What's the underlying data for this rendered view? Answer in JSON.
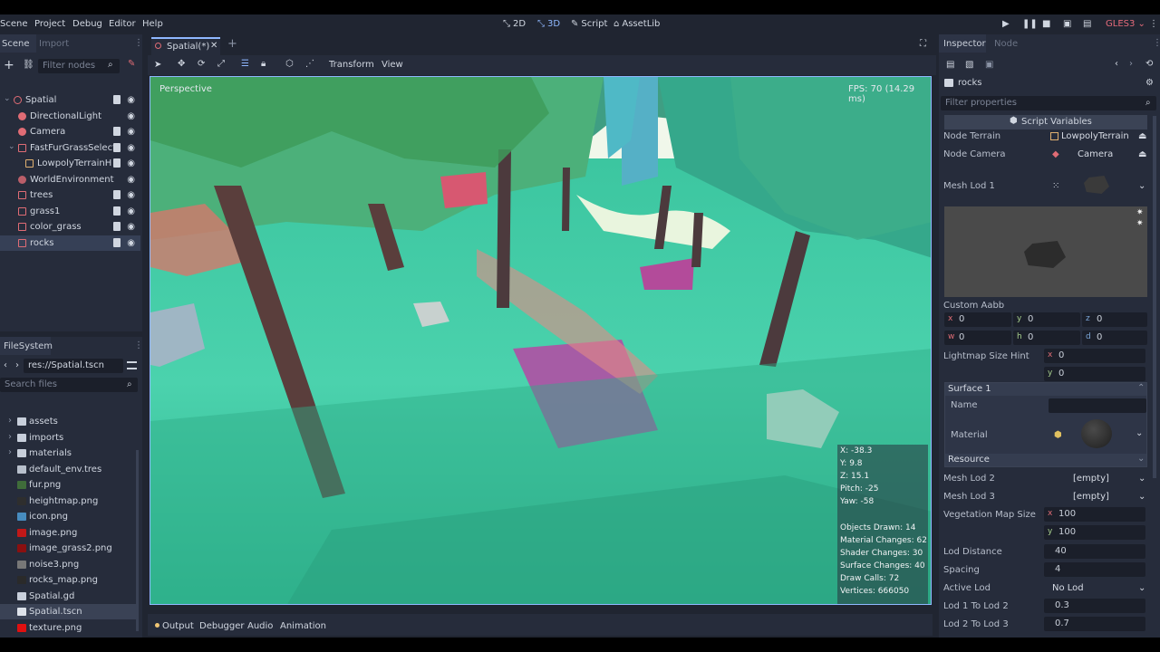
{
  "menu": [
    "Scene",
    "Project",
    "Debug",
    "Editor",
    "Help"
  ],
  "modes": {
    "d2": "2D",
    "d3": "3D",
    "script": "Script",
    "assetlib": "AssetLib"
  },
  "renderer": "GLES3",
  "scene_dock": {
    "tabs": [
      "Scene",
      "Import"
    ],
    "filter_placeholder": "Filter nodes",
    "nodes": [
      {
        "label": "Spatial"
      },
      {
        "label": "DirectionalLight"
      },
      {
        "label": "Camera"
      },
      {
        "label": "FastFurGrassSelecti"
      },
      {
        "label": "LowpolyTerrainH"
      },
      {
        "label": "WorldEnvironment"
      },
      {
        "label": "trees"
      },
      {
        "label": "grass1"
      },
      {
        "label": "color_grass"
      },
      {
        "label": "rocks"
      }
    ]
  },
  "filesystem": {
    "title": "FileSystem",
    "path": "res://Spatial.tscn",
    "search_placeholder": "Search files",
    "items": [
      {
        "label": "assets",
        "color": "#c8cfdb"
      },
      {
        "label": "imports",
        "color": "#c8cfdb"
      },
      {
        "label": "materials",
        "color": "#c8cfdb"
      },
      {
        "label": "default_env.tres",
        "color": "#b8c0cc"
      },
      {
        "label": "fur.png",
        "color": "#3f6c3a"
      },
      {
        "label": "heightmap.png",
        "color": "#2e2e2e"
      },
      {
        "label": "icon.png",
        "color": "#478cbf"
      },
      {
        "label": "image.png",
        "color": "#c01818"
      },
      {
        "label": "image_grass2.png",
        "color": "#8a1010"
      },
      {
        "label": "noise3.png",
        "color": "#777777"
      },
      {
        "label": "rocks_map.png",
        "color": "#2a2a2a"
      },
      {
        "label": "Spatial.gd",
        "color": "#c8cfdb"
      },
      {
        "label": "Spatial.tscn",
        "color": "#dde2ea"
      },
      {
        "label": "texture.png",
        "color": "#e01010"
      }
    ]
  },
  "editor_tab": "Spatial(*)",
  "viewport_toolbar": {
    "transform": "Transform",
    "view": "View"
  },
  "viewport": {
    "perspective": "Perspective",
    "fps": "FPS: 70 (14.29 ms)",
    "info": {
      "x": "X: -38.3",
      "y": "Y: 9.8",
      "z": "Z: 15.1",
      "pitch": "Pitch: -25",
      "yaw": "Yaw: -58",
      "objects": "Objects Drawn: 14",
      "material": "Material Changes: 62",
      "shader": "Shader Changes: 30",
      "surface": "Surface Changes: 40",
      "drawcalls": "Draw Calls: 72",
      "vertices": "Vertices: 666050"
    }
  },
  "bottom_tabs": [
    "Output",
    "Debugger",
    "Audio",
    "Animation"
  ],
  "inspector": {
    "tabs": [
      "Inspector",
      "Node"
    ],
    "object": "rocks",
    "filter_placeholder": "Filter properties",
    "script_vars": "Script Variables",
    "node_terrain": {
      "k": "Node Terrain",
      "v": "LowpolyTerrain"
    },
    "node_camera": {
      "k": "Node Camera",
      "v": "Camera"
    },
    "mesh_lod1": "Mesh Lod 1",
    "custom_aabb": "Custom Aabb",
    "aabb": {
      "x": "0",
      "y": "0",
      "z": "0",
      "w": "0",
      "h": "0",
      "d": "0"
    },
    "axes": {
      "x": "x",
      "y": "y",
      "z": "z",
      "w": "w",
      "h": "h",
      "d": "d"
    },
    "lightmap": {
      "k": "Lightmap Size Hint",
      "x": "0",
      "y": "0"
    },
    "surface1": "Surface 1",
    "name_k": "Name",
    "material_k": "Material",
    "resource": "Resource",
    "mesh_lod2": {
      "k": "Mesh Lod 2",
      "v": "[empty]"
    },
    "mesh_lod3": {
      "k": "Mesh Lod 3",
      "v": "[empty]"
    },
    "veg_map": {
      "k": "Vegetation Map Size",
      "x": "100",
      "y": "100"
    },
    "lod_distance": {
      "k": "Lod Distance",
      "v": "40"
    },
    "spacing": {
      "k": "Spacing",
      "v": "4"
    },
    "active_lod": {
      "k": "Active Lod",
      "v": "No Lod"
    },
    "lod1to2": {
      "k": "Lod 1 To Lod 2",
      "v": "0.3"
    },
    "lod2to3": {
      "k": "Lod 2 To Lod 3",
      "v": "0.7"
    }
  }
}
